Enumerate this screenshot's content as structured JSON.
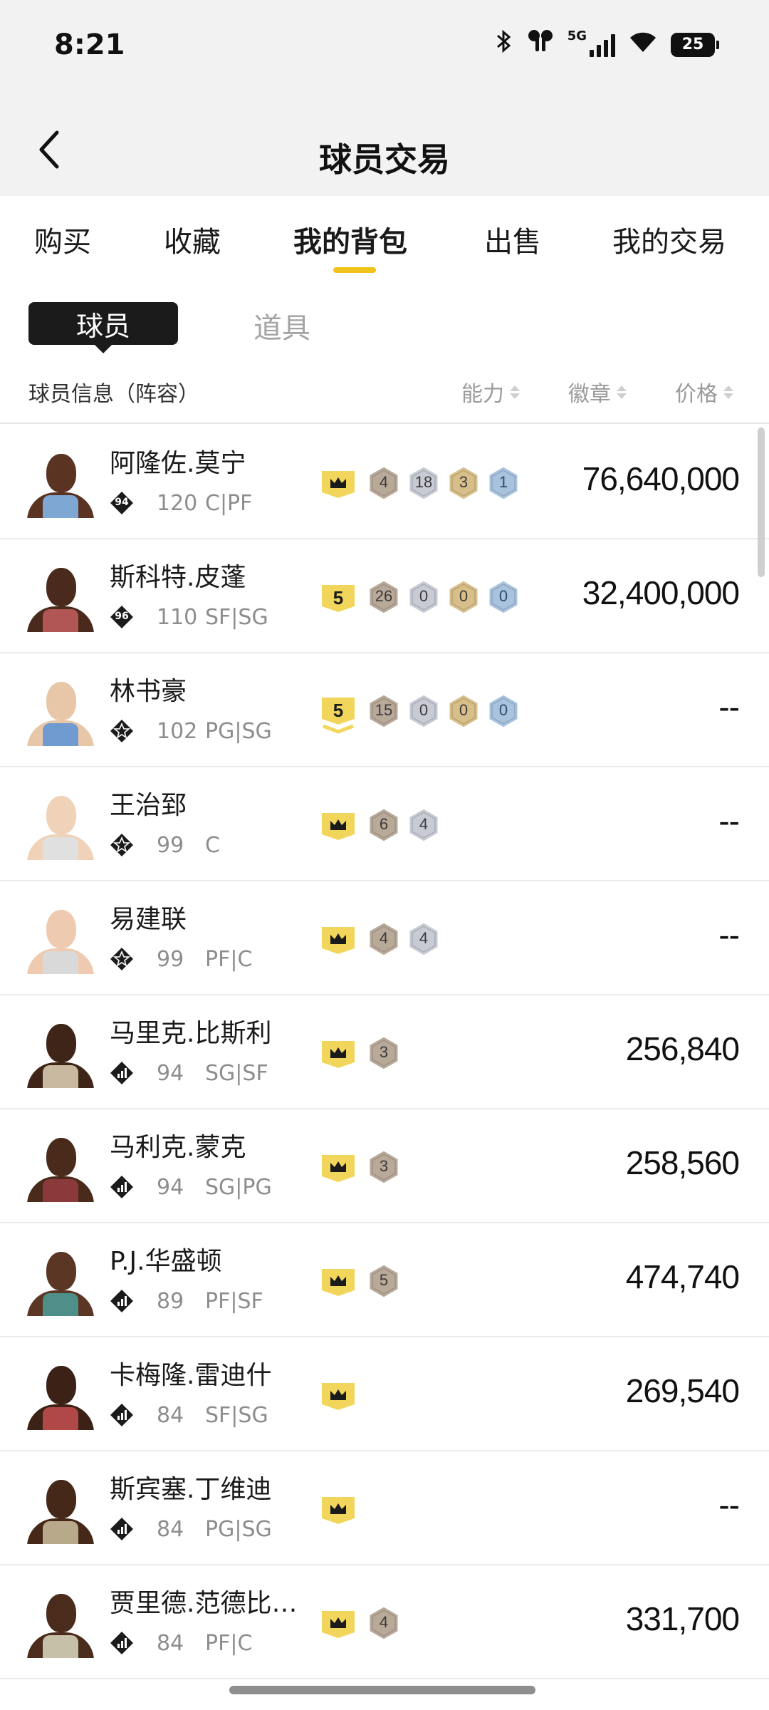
{
  "status": {
    "time": "8:21",
    "network": "5G",
    "battery": "25"
  },
  "header": {
    "title": "球员交易"
  },
  "tabs": [
    {
      "label": "购买",
      "active": false
    },
    {
      "label": "收藏",
      "active": false
    },
    {
      "label": "我的背包",
      "active": true
    },
    {
      "label": "出售",
      "active": false
    },
    {
      "label": "我的交易",
      "active": false
    }
  ],
  "subtabs": {
    "player": "球员",
    "item": "道具"
  },
  "list_header": {
    "info": "球员信息（阵容）",
    "ability": "能力",
    "badge": "徽章",
    "price": "价格"
  },
  "colors": {
    "accent": "#f0c21a",
    "crown_gold": "#f2d65c",
    "bronze": "#b9a999",
    "silver": "#c8cbd4",
    "gold": "#d8bf8a",
    "blue": "#a9c3de"
  },
  "players": [
    {
      "name": "阿隆佐.莫宁",
      "tier": "94",
      "tier_type": "num",
      "ovr": "120",
      "pos": "C|PF",
      "cap": "crown",
      "badges": [
        [
          "bronze",
          "4"
        ],
        [
          "silver",
          "18"
        ],
        [
          "gold",
          "3"
        ],
        [
          "blue",
          "1"
        ]
      ],
      "price": "76,640,000",
      "skin": "#5a3322",
      "jersey": "#7ea7d4"
    },
    {
      "name": "斯科特.皮蓬",
      "tier": "96",
      "tier_type": "num",
      "ovr": "110",
      "pos": "SF|SG",
      "cap": "5",
      "badges": [
        [
          "bronze",
          "26"
        ],
        [
          "silver",
          "0"
        ],
        [
          "gold",
          "0"
        ],
        [
          "blue",
          "0"
        ]
      ],
      "price": "32,400,000",
      "skin": "#4a2a1c",
      "jersey": "#b25555"
    },
    {
      "name": "林书豪",
      "tier": "",
      "tier_type": "star",
      "ovr": "102",
      "pos": "PG|SG",
      "cap": "5v",
      "badges": [
        [
          "bronze",
          "15"
        ],
        [
          "silver",
          "0"
        ],
        [
          "gold",
          "0"
        ],
        [
          "blue",
          "0"
        ]
      ],
      "price": "--",
      "skin": "#e8c7a8",
      "jersey": "#6f9bd0"
    },
    {
      "name": "王治郅",
      "tier": "",
      "tier_type": "star",
      "ovr": "99",
      "pos": "C",
      "cap": "crown",
      "badges": [
        [
          "bronze",
          "6"
        ],
        [
          "silver",
          "4"
        ]
      ],
      "price": "--",
      "skin": "#f0d2b8",
      "jersey": "#e0e0e0"
    },
    {
      "name": "易建联",
      "tier": "",
      "tier_type": "star",
      "ovr": "99",
      "pos": "PF|C",
      "cap": "crown",
      "badges": [
        [
          "bronze",
          "4"
        ],
        [
          "silver",
          "4"
        ]
      ],
      "price": "--",
      "skin": "#eecbb0",
      "jersey": "#d9d9d9"
    },
    {
      "name": "马里克.比斯利",
      "tier": "",
      "tier_type": "bars",
      "ovr": "94",
      "pos": "SG|SF",
      "cap": "crown",
      "badges": [
        [
          "bronze",
          "3"
        ]
      ],
      "price": "256,840",
      "skin": "#3f2418",
      "jersey": "#c9b9a0"
    },
    {
      "name": "马利克.蒙克",
      "tier": "",
      "tier_type": "bars",
      "ovr": "94",
      "pos": "SG|PG",
      "cap": "crown",
      "badges": [
        [
          "bronze",
          "3"
        ]
      ],
      "price": "258,560",
      "skin": "#4a2a1b",
      "jersey": "#8a3a3a"
    },
    {
      "name": "P.J.华盛顿",
      "tier": "",
      "tier_type": "bars",
      "ovr": "89",
      "pos": "PF|SF",
      "cap": "crown",
      "badges": [
        [
          "bronze",
          "5"
        ]
      ],
      "price": "474,740",
      "skin": "#5b3624",
      "jersey": "#4f8f8a"
    },
    {
      "name": "卡梅隆.雷迪什",
      "tier": "",
      "tier_type": "bars",
      "ovr": "84",
      "pos": "SF|SG",
      "cap": "crown",
      "badges": [],
      "price": "269,540",
      "skin": "#3c2216",
      "jersey": "#b04848"
    },
    {
      "name": "斯宾塞.丁维迪",
      "tier": "",
      "tier_type": "bars",
      "ovr": "84",
      "pos": "PG|SG",
      "cap": "crown",
      "badges": [],
      "price": "--",
      "skin": "#452818",
      "jersey": "#b8a98a"
    },
    {
      "name": "贾里德.范德比…",
      "tier": "",
      "tier_type": "bars",
      "ovr": "84",
      "pos": "PF|C",
      "cap": "crown",
      "badges": [
        [
          "bronze",
          "4"
        ]
      ],
      "price": "331,700",
      "skin": "#4b2b1c",
      "jersey": "#c7c0a8"
    }
  ]
}
